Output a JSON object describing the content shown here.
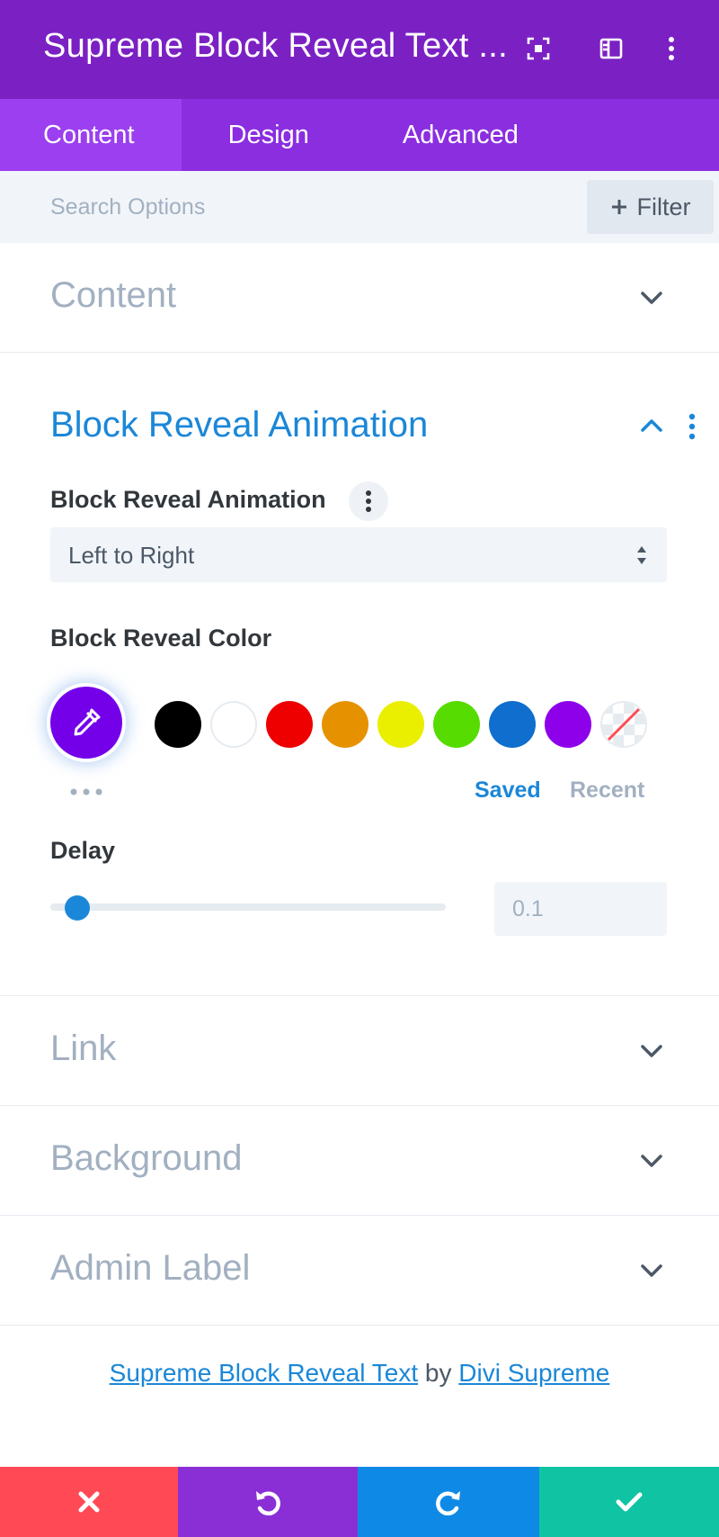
{
  "header": {
    "title": "Supreme Block Reveal Text ...",
    "icons": [
      "focus-icon",
      "split-view-icon",
      "more-vertical-icon"
    ],
    "background": "#7b21c4"
  },
  "tabs": [
    {
      "label": "Content",
      "active": true
    },
    {
      "label": "Design",
      "active": false
    },
    {
      "label": "Advanced",
      "active": false
    }
  ],
  "search": {
    "placeholder": "Search Options",
    "filter_label": "Filter"
  },
  "sections": {
    "content": {
      "title": "Content",
      "expanded": false
    },
    "block_reveal": {
      "title": "Block Reveal Animation",
      "expanded": true,
      "animation_label": "Block Reveal Animation",
      "animation_value": "Left to Right",
      "color_label": "Block Reveal Color",
      "selected_color": "#7400ea",
      "swatches": [
        {
          "name": "black",
          "color": "#000000"
        },
        {
          "name": "white",
          "color": "#ffffff"
        },
        {
          "name": "red",
          "color": "#ee0000"
        },
        {
          "name": "orange",
          "color": "#e69200"
        },
        {
          "name": "yellow",
          "color": "#eaef00"
        },
        {
          "name": "green",
          "color": "#56dc00"
        },
        {
          "name": "blue",
          "color": "#0f6ece"
        },
        {
          "name": "purple",
          "color": "#8e00ea"
        },
        {
          "name": "transparent",
          "color": "transparent"
        }
      ],
      "saved_label": "Saved",
      "recent_label": "Recent",
      "delay_label": "Delay",
      "delay_value": "0.1",
      "delay_fraction": 0.05
    },
    "link": {
      "title": "Link",
      "expanded": false
    },
    "background": {
      "title": "Background",
      "expanded": false
    },
    "admin_label": {
      "title": "Admin Label",
      "expanded": false
    }
  },
  "credit": {
    "module": "Supreme Block Reveal Text",
    "by": "by",
    "author": "Divi Supreme"
  },
  "bottom_bar": {
    "buttons": [
      {
        "name": "cancel",
        "icon": "close-icon",
        "color": "#ff4a55"
      },
      {
        "name": "undo",
        "icon": "undo-icon",
        "color": "#8a2fd6"
      },
      {
        "name": "redo",
        "icon": "redo-icon",
        "color": "#0e8ae6"
      },
      {
        "name": "save",
        "icon": "check-icon",
        "color": "#10c3a3"
      }
    ]
  },
  "accent_color": "#1b87d8"
}
